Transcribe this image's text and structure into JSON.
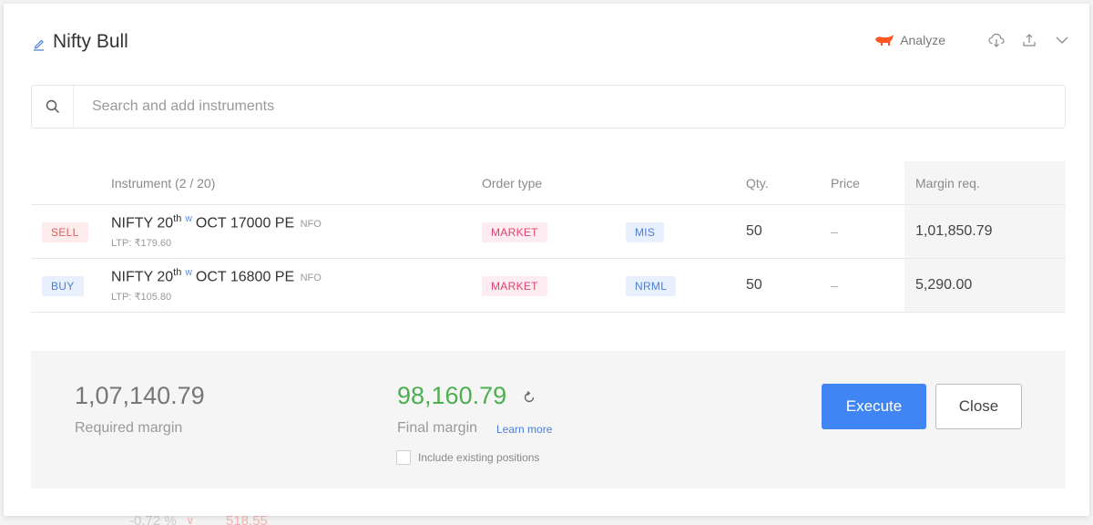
{
  "background": {
    "bottom_change": "-0.72 %",
    "bottom_price": "518.55"
  },
  "header": {
    "title": "Nifty Bull",
    "analyze_label": "Analyze"
  },
  "search": {
    "placeholder": "Search and add instruments"
  },
  "table": {
    "headers": {
      "instrument": "Instrument (2 / 20)",
      "order_type": "Order type",
      "qty": "Qty.",
      "price": "Price",
      "margin": "Margin req."
    },
    "rows": [
      {
        "side": "SELL",
        "symbol": "NIFTY 20",
        "day_suffix": "th",
        "weekly": "W",
        "contract": "OCT 17000 PE",
        "exchange": "NFO",
        "ltp": "LTP: ₹179.60",
        "order_type": "MARKET",
        "product": "MIS",
        "qty": "50",
        "price": "–",
        "margin": "1,01,850.79"
      },
      {
        "side": "BUY",
        "symbol": "NIFTY 20",
        "day_suffix": "th",
        "weekly": "W",
        "contract": "OCT 16800 PE",
        "exchange": "NFO",
        "ltp": "LTP: ₹105.80",
        "order_type": "MARKET",
        "product": "NRML",
        "qty": "50",
        "price": "–",
        "margin": "5,290.00"
      }
    ]
  },
  "footer": {
    "required_margin_value": "1,07,140.79",
    "required_margin_label": "Required margin",
    "final_margin_value": "98,160.79",
    "final_margin_label": "Final margin",
    "learn_more": "Learn more",
    "include_positions": "Include existing positions",
    "execute_label": "Execute",
    "close_label": "Close"
  },
  "colors": {
    "accent_blue": "#4184f3",
    "final_green": "#4caf50",
    "sell_red": "#e15b5b",
    "analyze_orange": "#ff5722"
  }
}
